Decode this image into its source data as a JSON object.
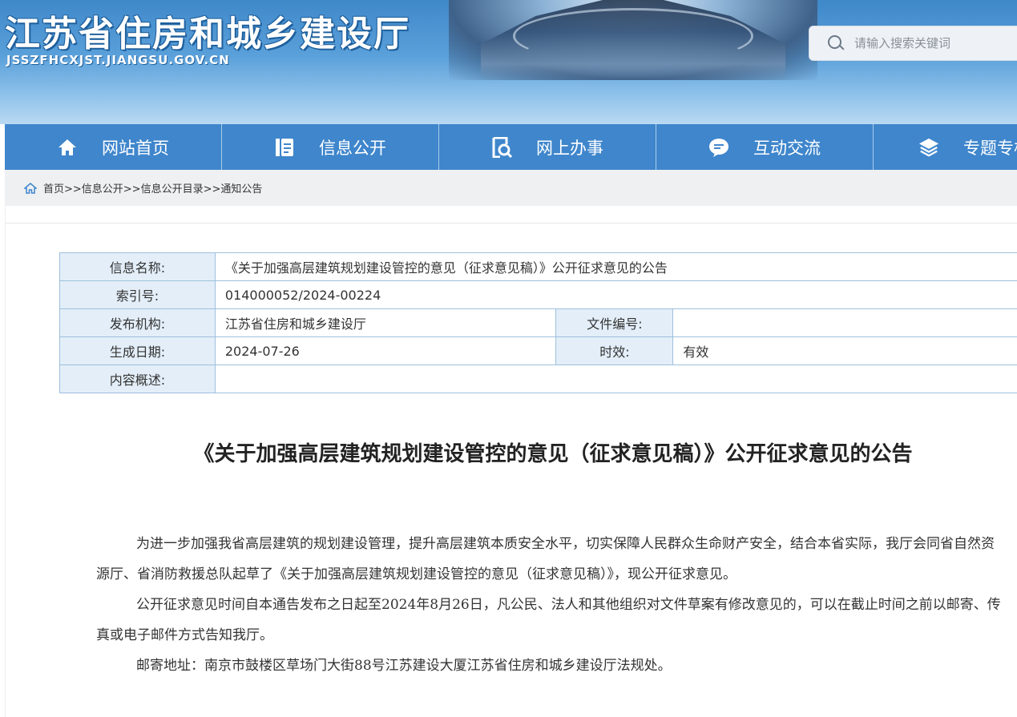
{
  "header": {
    "site_title": "江苏省住房和城乡建设厅",
    "site_domain": "JSSZFHCXJST.JIANGSU.GOV.CN",
    "search_placeholder": "请输入搜索关键词"
  },
  "nav": [
    {
      "label": "网站首页",
      "icon": "home-icon"
    },
    {
      "label": "信息公开",
      "icon": "document-list-icon"
    },
    {
      "label": "网上办事",
      "icon": "search-document-icon"
    },
    {
      "label": "互动交流",
      "icon": "chat-bubble-icon"
    },
    {
      "label": "专题专栏",
      "icon": "layers-icon"
    }
  ],
  "breadcrumb": "首页>>信息公开>>信息公开目录>>通知公告",
  "info": {
    "name_label": "信息名称:",
    "name_value": "《关于加强高层建筑规划建设管控的意见（征求意见稿）》公开征求意见的公告",
    "index_label": "索引号:",
    "index_value": "014000052/2024-00224",
    "org_label": "发布机构:",
    "org_value": "江苏省住房和城乡建设厅",
    "docno_label": "文件编号:",
    "docno_value": "",
    "date_label": "生成日期:",
    "date_value": "2024-07-26",
    "validity_label": "时效:",
    "validity_value": "有效",
    "summary_label": "内容概述:",
    "summary_value": ""
  },
  "article": {
    "title": "《关于加强高层建筑规划建设管控的意见（征求意见稿）》公开征求意见的公告",
    "paragraphs": [
      "为进一步加强我省高层建筑的规划建设管理，提升高层建筑本质安全水平，切实保障人民群众生命财产安全，结合本省实际，我厅会同省自然资源厅、省消防救援总队起草了《关于加强高层建筑规划建设管控的意见（征求意见稿）》，现公开征求意见。",
      "公开征求意见时间自本通告发布之日起至2024年8月26日，凡公民、法人和其他组织对文件草案有修改意见的，可以在截止时间之前以邮寄、传真或电子邮件方式告知我厅。",
      "邮寄地址：南京市鼓楼区草场门大街88号江苏建设大厦江苏省住房和城乡建设厅法规处。"
    ]
  },
  "colors": {
    "nav_bg": "#3f86cc",
    "table_label_bg": "#e3eef8",
    "table_border": "#9ec0dd"
  }
}
